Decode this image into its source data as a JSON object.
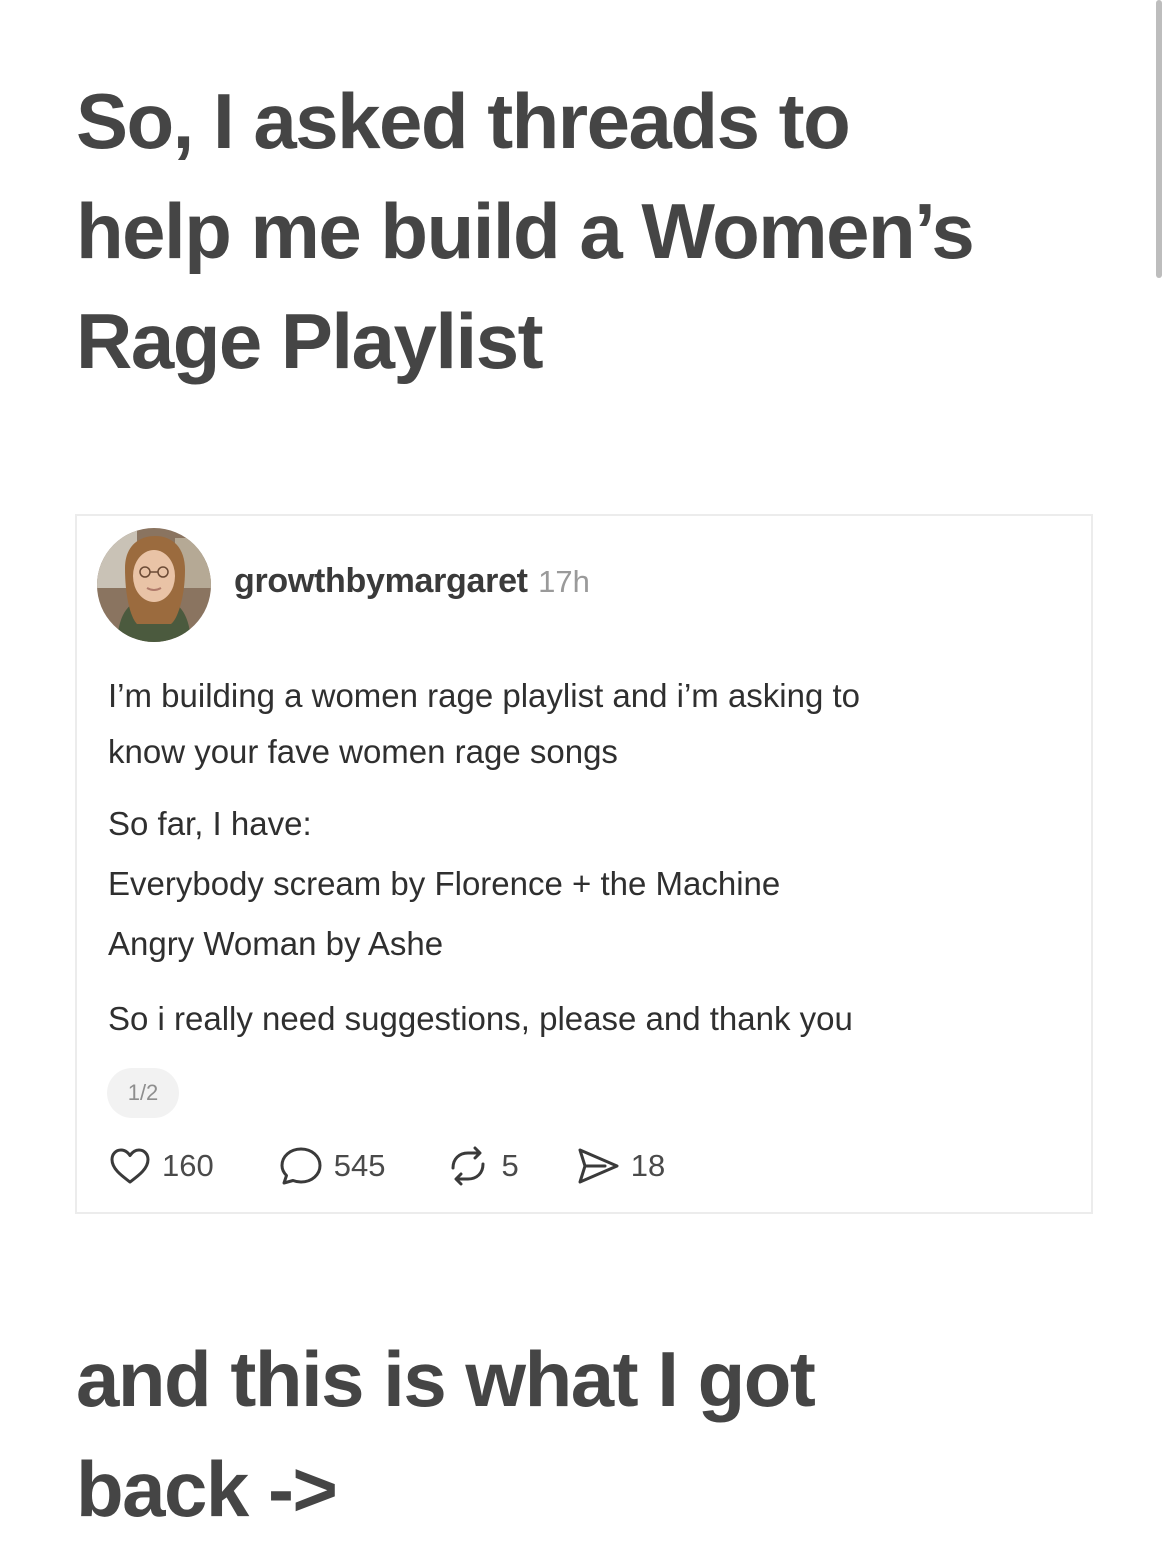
{
  "headline_top": {
    "lines": [
      "So, I asked threads to",
      "help me build a Women’s",
      "Rage Playlist"
    ]
  },
  "post": {
    "username": "growthbymargaret",
    "timestamp": "17h",
    "body": {
      "intro_line1": "I’m building a women rage playlist and i’m asking to",
      "intro_line2": "know your fave women rage songs",
      "so_far": "So far, I have:",
      "songs": [
        "Everybody scream by Florence + the Machine",
        "Angry Woman by Ashe"
      ],
      "closing": "So i really need suggestions, please and thank you"
    },
    "page_indicator": "1/2",
    "actions": {
      "likes": "160",
      "replies": "545",
      "reposts": "5",
      "shares": "18"
    },
    "icons": {
      "like": "heart-icon",
      "reply": "comment-bubble-icon",
      "repost": "repost-icon",
      "share": "paper-plane-icon"
    }
  },
  "headline_bottom": {
    "lines": [
      "and this is what I got",
      "back ->"
    ]
  },
  "colors": {
    "headline": "#454545",
    "body_text": "#2f2f2f",
    "muted": "#9a9a9a",
    "card_border": "#ececec"
  }
}
